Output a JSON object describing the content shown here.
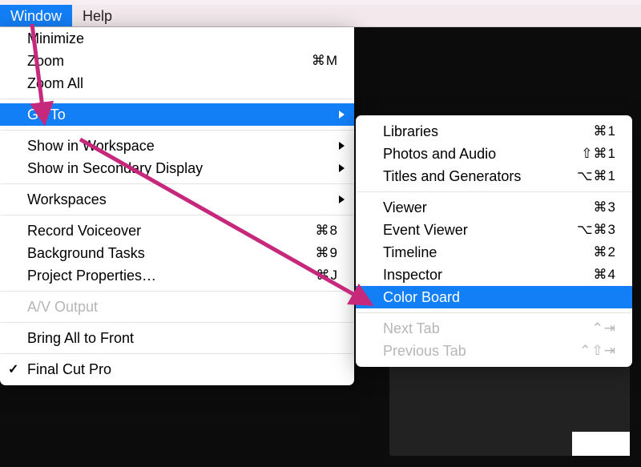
{
  "menubar": {
    "window": "Window",
    "help": "Help"
  },
  "windowMenu": {
    "minimize": "Minimize",
    "zoom": "Zoom",
    "zoomShortcut": "⌘M",
    "zoomAll": "Zoom All",
    "goto": "Go To",
    "showWorkspace": "Show in Workspace",
    "showSecondary": "Show in Secondary Display",
    "workspaces": "Workspaces",
    "recordVoiceover": "Record Voiceover",
    "recordVoiceoverShortcut": "⌘8",
    "bgTasks": "Background Tasks",
    "bgTasksShortcut": "⌘9",
    "projectProps": "Project Properties…",
    "projectPropsShortcut": "⌘J",
    "avOutput": "A/V Output",
    "bringAll": "Bring All to Front",
    "app": "Final Cut Pro"
  },
  "gotoSubmenu": {
    "libraries": "Libraries",
    "librariesShortcut": "⌘1",
    "photos": "Photos and Audio",
    "photosShortcut": "⇧⌘1",
    "titles": "Titles and Generators",
    "titlesShortcut": "⌥⌘1",
    "viewer": "Viewer",
    "viewerShortcut": "⌘3",
    "eventViewer": "Event Viewer",
    "eventViewerShortcut": "⌥⌘3",
    "timeline": "Timeline",
    "timelineShortcut": "⌘2",
    "inspector": "Inspector",
    "inspectorShortcut": "⌘4",
    "colorBoard": "Color Board",
    "nextTab": "Next Tab",
    "nextTabShortcut": "⌃⇥",
    "prevTab": "Previous Tab",
    "prevTabShortcut": "⌃⇧⇥"
  },
  "annotation": {
    "arrowColor": "#c6297c"
  }
}
